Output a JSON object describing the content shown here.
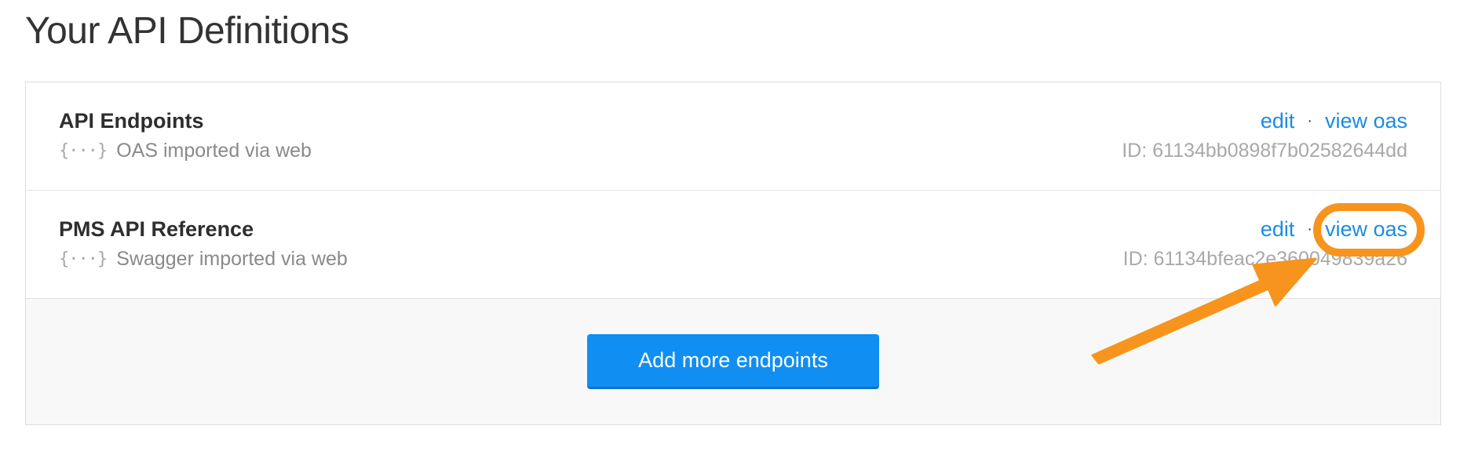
{
  "page": {
    "title": "Your API Definitions"
  },
  "definitions": [
    {
      "name": "API Endpoints",
      "source": "OAS imported via web",
      "icon": "braces-icon",
      "icon_glyph": "{···}",
      "edit_label": "edit",
      "separator": "·",
      "view_label": "view oas",
      "id_text": "ID: 61134bb0898f7b02582644dd"
    },
    {
      "name": "PMS API Reference",
      "source": "Swagger imported via web",
      "icon": "braces-icon",
      "icon_glyph": "{···}",
      "edit_label": "edit",
      "separator": "·",
      "view_label": "view oas",
      "id_text": "ID: 61134bfeac2e360049839a26"
    }
  ],
  "footer": {
    "add_button_label": "Add more endpoints"
  },
  "colors": {
    "link": "#1b8ce3",
    "button": "#118ef2",
    "annotation": "#f7941d"
  }
}
